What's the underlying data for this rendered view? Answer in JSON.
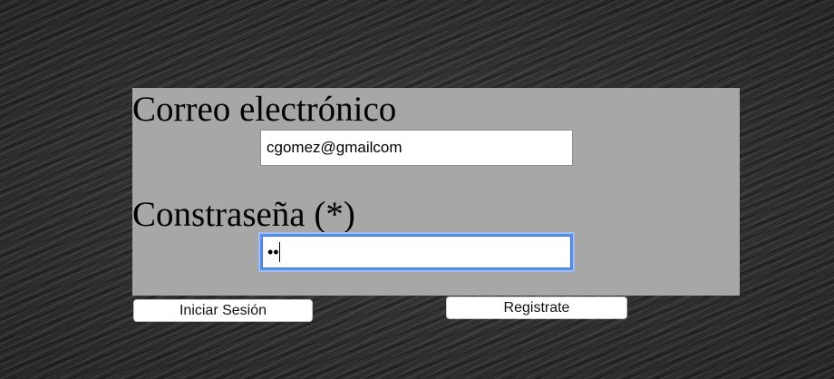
{
  "form": {
    "email_label": "Correo electrónico",
    "email_value": "cgomez@gmailcom",
    "password_label": "Constraseña (*)",
    "password_mask": "••"
  },
  "actions": {
    "login_label": "Iniciar Sesión",
    "register_label": "Registrate"
  },
  "colors": {
    "panel_background": "#a7a7a7",
    "focus_ring": "#5a90ea"
  }
}
